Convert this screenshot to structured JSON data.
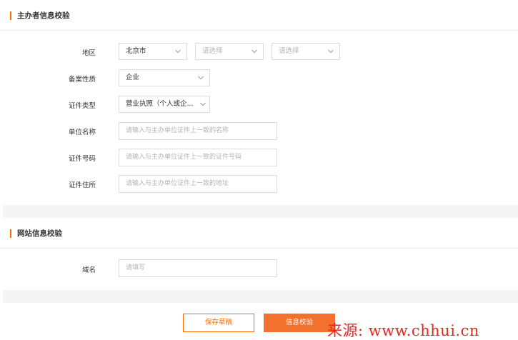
{
  "sections": {
    "sponsor": {
      "title": "主办者信息校验"
    },
    "website": {
      "title": "网站信息校验"
    }
  },
  "fields": {
    "region": {
      "label": "地区",
      "province": "北京市",
      "city_placeholder": "请选择",
      "district_placeholder": "请选择"
    },
    "filing_nature": {
      "label": "备案性质",
      "value": "企业"
    },
    "cert_type": {
      "label": "证件类型",
      "value": "营业执照（个人或企..."
    },
    "unit_name": {
      "label": "单位名称",
      "placeholder": "请输入与主办单位证件上一致的名称"
    },
    "cert_number": {
      "label": "证件号码",
      "placeholder": "请输入与主办单位证件上一致的证件号码"
    },
    "cert_address": {
      "label": "证件住所",
      "placeholder": "请输入与主办单位证件上一致的地址"
    },
    "domain": {
      "label": "域名",
      "placeholder": "请填写"
    }
  },
  "actions": {
    "save_draft": "保存草稿",
    "verify": "信息校验"
  },
  "watermark": "来源: www.chhui.cn",
  "colors": {
    "accent": "#ff6a00",
    "primary_button": "#f2722d",
    "watermark": "#e6261f",
    "divider_band": "#f5f5f5"
  }
}
